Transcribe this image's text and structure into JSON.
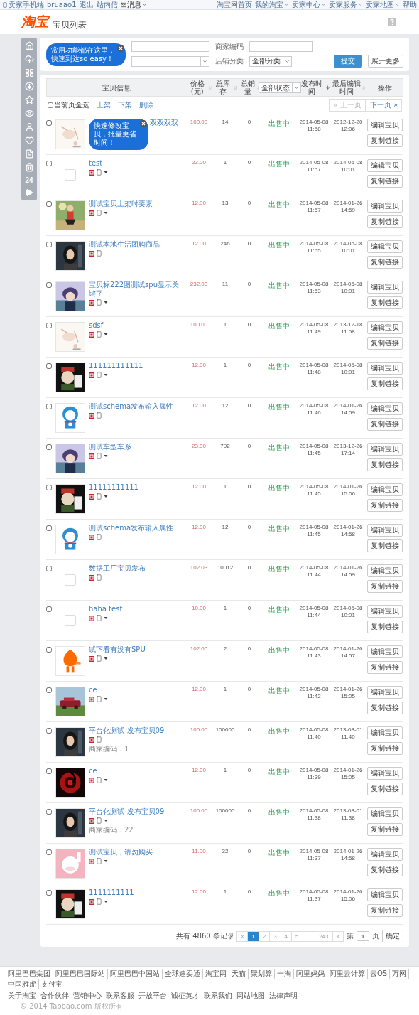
{
  "topbar": {
    "mobile": "卖家手机端",
    "user": "bruaao1",
    "logout": "退出",
    "inbox": "站内信",
    "messages": "消息",
    "right_menu": [
      {
        "label": "淘宝网首页",
        "dropdown": false
      },
      {
        "label": "我的淘宝",
        "dropdown": true
      },
      {
        "label": "卖家中心",
        "dropdown": true
      },
      {
        "label": "卖家服务",
        "dropdown": true
      },
      {
        "label": "卖家地图",
        "dropdown": true
      },
      {
        "label": "帮助",
        "dropdown": false
      }
    ]
  },
  "header": {
    "logo": "淘宝",
    "title": "宝贝列表"
  },
  "sidebar": {
    "counter": "24"
  },
  "filters": {
    "tip": "常用功能都在这里，快速到达so easy！",
    "merchant_code_label": "商家编码",
    "shop_category_label": "店铺分类",
    "shop_category_value": "全部分类",
    "submit": "提交",
    "expand": "展开更多"
  },
  "table": {
    "columns": [
      {
        "label": "宝贝信息",
        "kind": "plain"
      },
      {
        "label": "价格(元)",
        "kind": "sortable"
      },
      {
        "label": "总库存",
        "kind": "sortable"
      },
      {
        "label": "总销量",
        "kind": "sortable"
      },
      {
        "label": "全部状态",
        "kind": "select"
      },
      {
        "label": "发布时间",
        "kind": "sorted"
      },
      {
        "label": "最后编辑时间",
        "kind": "sortable"
      },
      {
        "label": "操作",
        "kind": "plain"
      }
    ],
    "toolbar": {
      "select_all": "当前页全选",
      "select_all_checked": false,
      "actions": [
        "上架",
        "下架",
        "删除"
      ],
      "prev": {
        "label": "« 上一页",
        "disabled": true
      },
      "next": {
        "label": "下一页 »",
        "disabled": false
      }
    },
    "rows": [
      {
        "checked": false,
        "thumb": {
          "kind": "picture"
        },
        "tip": "快速修改宝贝，批量更省时间！",
        "title": "双双双双",
        "badges": false,
        "price": "100.00",
        "stock": "14",
        "sales": "0",
        "status": "出售中",
        "published": {
          "date": "2014-05-08",
          "time": "11:58"
        },
        "edited": {
          "date": "2012-12-20",
          "time": "12:06"
        },
        "buttons": [
          "编辑宝贝",
          "复制链接"
        ]
      },
      {
        "checked": false,
        "thumb": {
          "kind": "placeholder"
        },
        "title": "test",
        "badges": true,
        "menu": true,
        "price": "23.00",
        "stock": "1",
        "sales": "0",
        "status": "出售中",
        "published": {
          "date": "2014-05-08",
          "time": "11:57"
        },
        "edited": {
          "date": "2014-05-08",
          "time": "10:01"
        },
        "buttons": [
          "编辑宝贝",
          "复制链接"
        ]
      },
      {
        "checked": false,
        "thumb": {
          "kind": "picture"
        },
        "title": "测试宝贝上架时要素",
        "badges": true,
        "menu": true,
        "price": "12.00",
        "stock": "13",
        "sales": "0",
        "status": "出售中",
        "published": {
          "date": "2014-05-08",
          "time": "11:57"
        },
        "edited": {
          "date": "2014-01-26",
          "time": "14:59"
        },
        "buttons": [
          "编辑宝贝",
          "复制链接"
        ]
      },
      {
        "checked": false,
        "thumb": {
          "kind": "picture"
        },
        "title": "测试本地生活团购商品",
        "badges": true,
        "menu": false,
        "price": "12.00",
        "stock": "246",
        "sales": "0",
        "status": "出售中",
        "published": {
          "date": "2014-05-08",
          "time": "11:55"
        },
        "edited": {
          "date": "2014-05-08",
          "time": "10:01"
        },
        "buttons": [
          "编辑宝贝",
          "复制链接"
        ]
      },
      {
        "checked": false,
        "thumb": {
          "kind": "picture"
        },
        "title": "宝贝标222图测试spu显示关键字",
        "badges": true,
        "menu": true,
        "price": "232.00",
        "stock": "11",
        "sales": "0",
        "status": "出售中",
        "published": {
          "date": "2014-05-08",
          "time": "11:53"
        },
        "edited": {
          "date": "2014-05-08",
          "time": "10:01"
        },
        "buttons": [
          "编辑宝贝",
          "复制链接"
        ]
      },
      {
        "checked": false,
        "thumb": {
          "kind": "picture"
        },
        "title": "sdsf",
        "badges": true,
        "menu": true,
        "price": "100.00",
        "stock": "1",
        "sales": "0",
        "status": "出售中",
        "published": {
          "date": "2014-05-08",
          "time": "11:49"
        },
        "edited": {
          "date": "2013-12-18",
          "time": "11:58"
        },
        "buttons": [
          "编辑宝贝",
          "复制链接"
        ]
      },
      {
        "checked": false,
        "thumb": {
          "kind": "picture"
        },
        "title": "111111111111",
        "badges": true,
        "menu": true,
        "price": "12.00",
        "stock": "1",
        "sales": "0",
        "status": "出售中",
        "published": {
          "date": "2014-05-08",
          "time": "11:48"
        },
        "edited": {
          "date": "2014-05-08",
          "time": "10:01"
        },
        "buttons": [
          "编辑宝贝",
          "复制链接"
        ]
      },
      {
        "checked": false,
        "thumb": {
          "kind": "picture"
        },
        "title": "测试schema发布输入属性",
        "badges": true,
        "menu": false,
        "price": "12.00",
        "stock": "12",
        "sales": "0",
        "status": "出售中",
        "published": {
          "date": "2014-05-08",
          "time": "11:46"
        },
        "edited": {
          "date": "2014-01-26",
          "time": "14:59"
        },
        "buttons": [
          "编辑宝贝",
          "复制链接"
        ]
      },
      {
        "checked": false,
        "thumb": {
          "kind": "picture"
        },
        "title": "测试车型车系",
        "badges": true,
        "menu": true,
        "price": "23.00",
        "stock": "792",
        "sales": "0",
        "status": "出售中",
        "published": {
          "date": "2014-05-08",
          "time": "11:45"
        },
        "edited": {
          "date": "2013-12-26",
          "time": "17:14"
        },
        "buttons": [
          "编辑宝贝",
          "复制链接"
        ]
      },
      {
        "checked": false,
        "thumb": {
          "kind": "picture"
        },
        "title": "11111111111",
        "badges": true,
        "menu": true,
        "price": "12.00",
        "stock": "1",
        "sales": "0",
        "status": "出售中",
        "published": {
          "date": "2014-05-08",
          "time": "11:45"
        },
        "edited": {
          "date": "2014-01-26",
          "time": "15:06"
        },
        "buttons": [
          "编辑宝贝",
          "复制链接"
        ]
      },
      {
        "checked": false,
        "thumb": {
          "kind": "picture"
        },
        "title": "测试schema发布输入属性",
        "badges": true,
        "menu": false,
        "price": "12.00",
        "stock": "12",
        "sales": "0",
        "status": "出售中",
        "published": {
          "date": "2014-05-08",
          "time": "11:45"
        },
        "edited": {
          "date": "2014-01-26",
          "time": "14:58"
        },
        "buttons": [
          "编辑宝贝",
          "复制链接"
        ]
      },
      {
        "checked": false,
        "thumb": {
          "kind": "placeholder"
        },
        "title": "数据工厂宝贝发布",
        "badges": true,
        "menu": false,
        "price": "102.03",
        "stock": "10012",
        "sales": "0",
        "status": "出售中",
        "published": {
          "date": "2014-05-08",
          "time": "11:44"
        },
        "edited": {
          "date": "2014-01-26",
          "time": "14:59"
        },
        "buttons": [
          "编辑宝贝",
          "复制链接"
        ]
      },
      {
        "checked": false,
        "thumb": {
          "kind": "placeholder"
        },
        "title": "haha test",
        "badges": true,
        "menu": true,
        "price": "10.00",
        "stock": "1",
        "sales": "0",
        "status": "出售中",
        "published": {
          "date": "2014-05-08",
          "time": "11:44"
        },
        "edited": {
          "date": "2014-05-08",
          "time": "10:01"
        },
        "buttons": [
          "编辑宝贝",
          "复制链接"
        ]
      },
      {
        "checked": false,
        "thumb": {
          "kind": "picture"
        },
        "title": "试下看有没有SPU",
        "badges": true,
        "menu": true,
        "price": "102.00",
        "stock": "2",
        "sales": "0",
        "status": "出售中",
        "published": {
          "date": "2014-05-08",
          "time": "11:43"
        },
        "edited": {
          "date": "2014-01-26",
          "time": "14:57"
        },
        "buttons": [
          "编辑宝贝",
          "复制链接"
        ]
      },
      {
        "checked": false,
        "thumb": {
          "kind": "picture"
        },
        "title": "ce",
        "badges": true,
        "menu": true,
        "price": "12.00",
        "stock": "1",
        "sales": "0",
        "status": "出售中",
        "published": {
          "date": "2014-05-08",
          "time": "11:42"
        },
        "edited": {
          "date": "2014-01-26",
          "time": "15:05"
        },
        "buttons": [
          "编辑宝贝",
          "复制链接"
        ]
      },
      {
        "checked": false,
        "thumb": {
          "kind": "picture"
        },
        "title": "平台化测试-发布宝贝09",
        "badges": true,
        "menu": false,
        "merchant_code": "商家编码：1",
        "price": "100.00",
        "stock": "100000",
        "sales": "0",
        "status": "出售中",
        "published": {
          "date": "2014-05-08",
          "time": "11:40"
        },
        "edited": {
          "date": "2013-08-01",
          "time": "11:40"
        },
        "buttons": [
          "编辑宝贝",
          "复制链接"
        ]
      },
      {
        "checked": false,
        "thumb": {
          "kind": "picture"
        },
        "title": "ce",
        "badges": true,
        "menu": true,
        "price": "12.00",
        "stock": "1",
        "sales": "0",
        "status": "出售中",
        "published": {
          "date": "2014-05-08",
          "time": "11:39"
        },
        "edited": {
          "date": "2014-01-26",
          "time": "15:05"
        },
        "buttons": [
          "编辑宝贝",
          "复制链接"
        ]
      },
      {
        "checked": false,
        "thumb": {
          "kind": "picture"
        },
        "title": "平台化测试-发布宝贝09",
        "badges": true,
        "menu": true,
        "merchant_code": "商家编码：22",
        "price": "100.00",
        "stock": "100000",
        "sales": "0",
        "status": "出售中",
        "published": {
          "date": "2014-05-08",
          "time": "11:38"
        },
        "edited": {
          "date": "2013-08-01",
          "time": "11:38"
        },
        "buttons": [
          "编辑宝贝",
          "复制链接"
        ]
      },
      {
        "checked": false,
        "thumb": {
          "kind": "picture"
        },
        "title": "测试宝贝，请勿购买",
        "badges": true,
        "menu": true,
        "price": "11.00",
        "stock": "32",
        "sales": "0",
        "status": "出售中",
        "published": {
          "date": "2014-05-08",
          "time": "11:37"
        },
        "edited": {
          "date": "2014-01-26",
          "time": "14:58"
        },
        "buttons": [
          "编辑宝贝",
          "复制链接"
        ]
      },
      {
        "checked": false,
        "thumb": {
          "kind": "picture"
        },
        "title": "1111111111",
        "badges": true,
        "menu": true,
        "price": "12.00",
        "stock": "1",
        "sales": "0",
        "status": "出售中",
        "published": {
          "date": "2014-05-08",
          "time": "11:37"
        },
        "edited": {
          "date": "2014-01-26",
          "time": "15:06"
        },
        "buttons": [
          "编辑宝贝",
          "复制链接"
        ]
      }
    ]
  },
  "pagination": {
    "total": "共有 4860 条记录",
    "prev": "«",
    "next": "»",
    "pages": [
      {
        "label": "1",
        "selected": true
      },
      {
        "label": "2",
        "selected": false
      },
      {
        "label": "3",
        "selected": false
      },
      {
        "label": "4",
        "selected": false
      },
      {
        "label": "5",
        "selected": false
      },
      {
        "label": "...",
        "selected": false
      },
      {
        "label": "243",
        "selected": false
      }
    ],
    "goto_prefix": "第",
    "goto_value": "1",
    "goto_suffix": "页",
    "confirm": "确定"
  },
  "footer": {
    "links": [
      "阿里巴巴集团",
      "阿里巴巴国际站",
      "阿里巴巴中国站",
      "全球速卖通",
      "淘宝网",
      "天猫",
      "聚划算",
      "一淘",
      "阿里妈妈",
      "阿里云计算",
      "云OS",
      "万网",
      "中国雅虎",
      "支付宝"
    ],
    "links2": [
      "关于淘宝",
      "合作伙伴",
      "营销中心",
      "联系客服",
      "开放平台",
      "诚征英才",
      "联系我们",
      "网站地图",
      "法律声明"
    ],
    "copyright": "© 2014 Taobao.com 版权所有"
  }
}
